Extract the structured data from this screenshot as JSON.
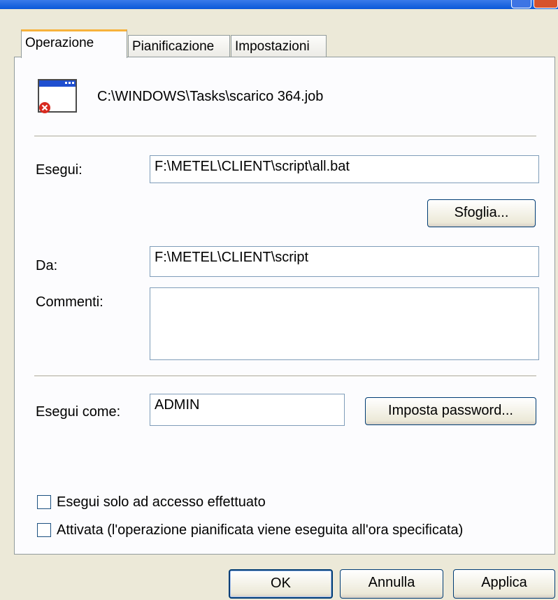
{
  "tabs": [
    {
      "label": "Operazione"
    },
    {
      "label": "Pianificazione"
    },
    {
      "label": "Impostazioni"
    }
  ],
  "task": {
    "path": "C:\\WINDOWS\\Tasks\\scarico 364.job",
    "icon": "scheduled-task-error-icon"
  },
  "run": {
    "label": "Esegui:",
    "value": "F:\\METEL\\CLIENT\\script\\all.bat",
    "browse_label": "Sfoglia..."
  },
  "start_in": {
    "label": "Da:",
    "value": "F:\\METEL\\CLIENT\\script"
  },
  "comments": {
    "label": "Commenti:",
    "value": ""
  },
  "run_as": {
    "label": "Esegui come:",
    "value": "ADMIN",
    "set_password_label": "Imposta password..."
  },
  "options": {
    "logged_on_only": {
      "label": "Esegui solo ad accesso effettuato",
      "checked": false
    },
    "enabled": {
      "label": "Attivata (l'operazione pianificata viene eseguita all'ora specificata)",
      "checked": false
    }
  },
  "footer": {
    "ok_label": "OK",
    "cancel_label": "Annulla",
    "apply_label": "Applica"
  },
  "colors": {
    "titlebar": "#0a58d8",
    "tab_highlight": "#f7b23c",
    "dialog_bg": "#ece9d8",
    "panel_bg": "#fcfcfe"
  }
}
